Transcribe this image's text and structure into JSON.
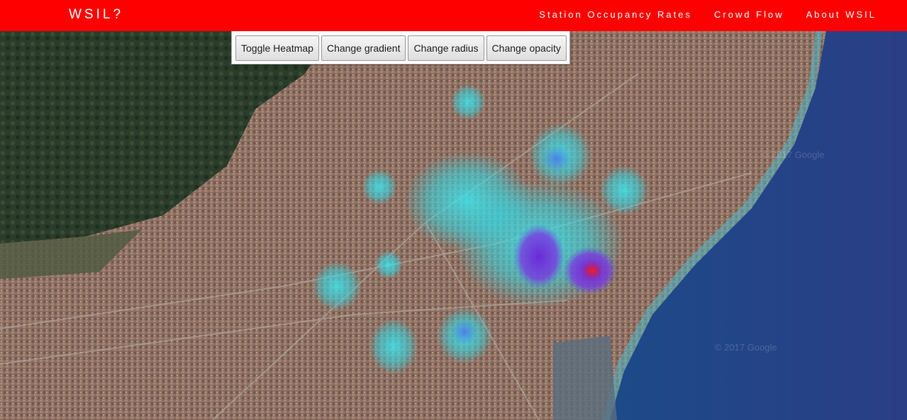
{
  "app": {
    "brand": "WSIL?"
  },
  "nav": {
    "items": [
      {
        "label": "Station Occupancy Rates"
      },
      {
        "label": "Crowd Flow"
      },
      {
        "label": "About WSIL"
      }
    ]
  },
  "controls": {
    "toggle_heatmap": "Toggle Heatmap",
    "change_gradient": "Change gradient",
    "change_radius": "Change radius",
    "change_opacity": "Change opacity"
  },
  "map": {
    "type": "satellite",
    "watermark": "© 2017 Google",
    "colors": {
      "sea": "#1f3a78",
      "hills": "#2b3d2a",
      "city": "#8a6a5a",
      "heat_low": "#34e0e8",
      "heat_mid": "#6a30d8",
      "heat_high": "#ff1a1a"
    }
  },
  "colors": {
    "navbar": "#ff0000",
    "nav_text": "#ffffff"
  }
}
